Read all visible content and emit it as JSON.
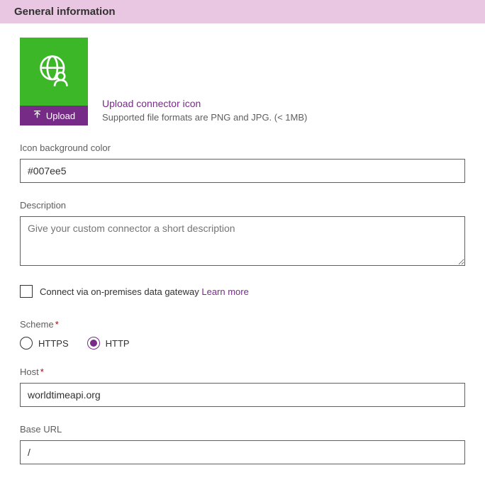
{
  "header": {
    "title": "General information"
  },
  "icon": {
    "upload_button": "Upload",
    "link_text": "Upload connector icon",
    "subtext": "Supported file formats are PNG and JPG. (< 1MB)"
  },
  "fields": {
    "bgcolor": {
      "label": "Icon background color",
      "value": "#007ee5"
    },
    "description": {
      "label": "Description",
      "placeholder": "Give your custom connector a short description",
      "value": ""
    },
    "host": {
      "label": "Host",
      "value": "worldtimeapi.org"
    },
    "baseurl": {
      "label": "Base URL",
      "value": "/"
    }
  },
  "checkbox": {
    "label": "Connect via on-premises data gateway",
    "link": "Learn more"
  },
  "scheme": {
    "label": "Scheme",
    "options": {
      "https": "HTTPS",
      "http": "HTTP"
    },
    "selected": "http"
  },
  "required_mark": "*"
}
